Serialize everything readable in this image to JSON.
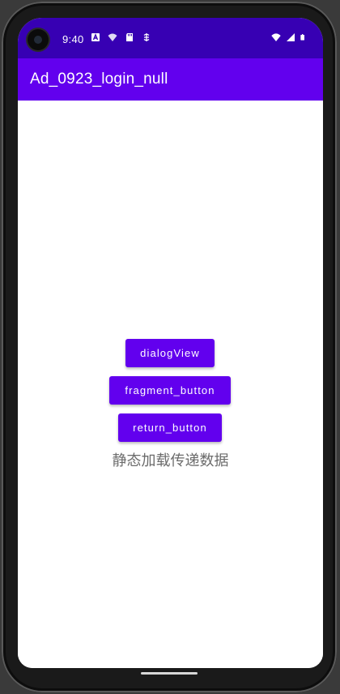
{
  "status_bar": {
    "time": "9:40",
    "left_icons": [
      "a-notification-icon",
      "wifi-notification-icon",
      "sd-card-icon",
      "sync-notification-icon"
    ],
    "right_icons": [
      "wifi-icon",
      "signal-icon",
      "battery-icon"
    ]
  },
  "app_bar": {
    "title": "Ad_0923_login_null"
  },
  "main": {
    "dialog_button": "dialogView",
    "fragment_button": "fragment_button",
    "return_button": "return_button",
    "static_text": "静态加载传递数据"
  },
  "colors": {
    "status_bar": "#3700b3",
    "app_bar": "#6200ee",
    "button": "#6200ee"
  }
}
